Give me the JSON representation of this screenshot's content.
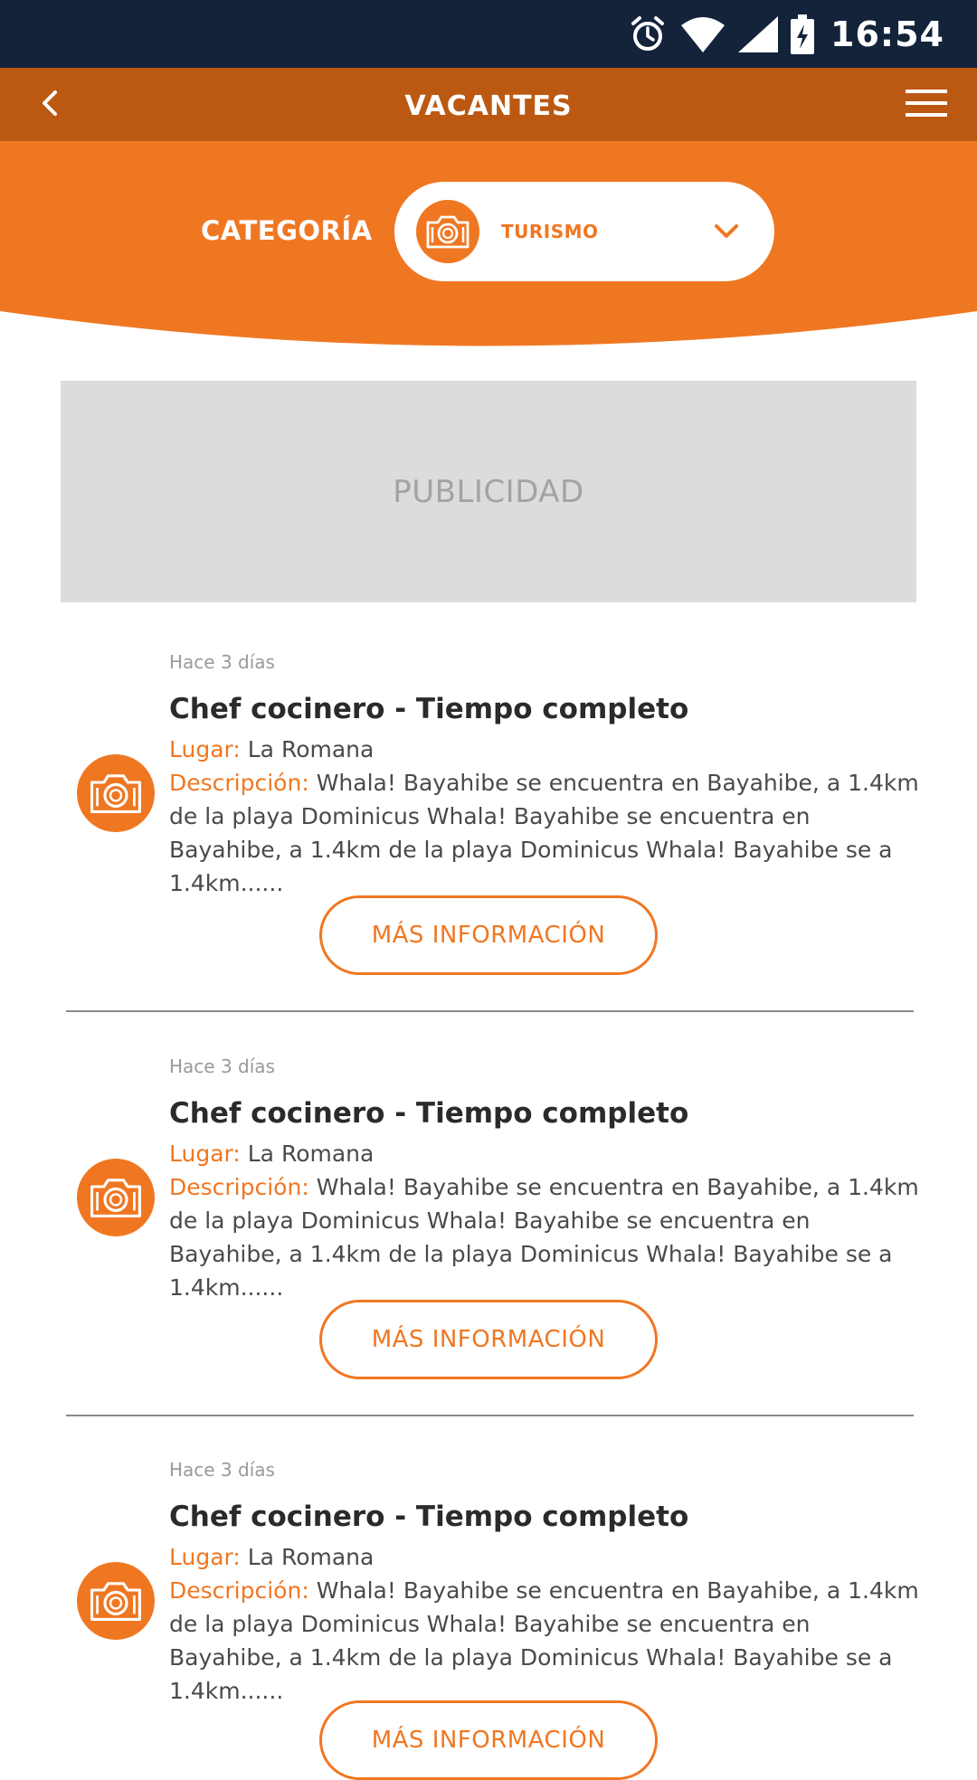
{
  "status": {
    "time": "16:54"
  },
  "header": {
    "title": "VACANTES"
  },
  "category": {
    "label": "CATEGORÍA",
    "selected": "TURISMO"
  },
  "ad": {
    "label": "PUBLICIDAD"
  },
  "jobs": [
    {
      "time_ago": "Hace 3 días",
      "title": "Chef cocinero - Tiempo completo",
      "place_label": "Lugar:",
      "place": "La Romana",
      "desc_label": "Descripción:",
      "desc": "Whala! Bayahibe se encuentra en Bayahibe, a 1.4km de la playa Dominicus Whala! Bayahibe se encuentra en Bayahibe, a 1.4km de la playa Dominicus Whala! Bayahibe se a 1.4km......",
      "button": "MÁS INFORMACIÓN"
    },
    {
      "time_ago": "Hace 3 días",
      "title": "Chef cocinero - Tiempo completo",
      "place_label": "Lugar:",
      "place": "La Romana",
      "desc_label": "Descripción:",
      "desc": "Whala! Bayahibe se encuentra en Bayahibe, a 1.4km de la playa Dominicus Whala! Bayahibe se encuentra en Bayahibe, a 1.4km de la playa Dominicus Whala! Bayahibe se a 1.4km......",
      "button": "MÁS INFORMACIÓN"
    },
    {
      "time_ago": "Hace 3 días",
      "title": "Chef cocinero - Tiempo completo",
      "place_label": "Lugar:",
      "place": "La Romana",
      "desc_label": "Descripción:",
      "desc": "Whala! Bayahibe se encuentra en Bayahibe, a 1.4km de la playa Dominicus Whala! Bayahibe se encuentra en Bayahibe, a 1.4km de la playa Dominicus Whala! Bayahibe se a 1.4km......",
      "button": "MÁS INFORMACIÓN"
    }
  ],
  "colors": {
    "accent": "#f07722",
    "appbar": "#bb5912",
    "statusbar": "#13233a"
  },
  "icons": [
    "alarm-icon",
    "wifi-icon",
    "signal-icon",
    "battery-icon",
    "back-icon",
    "menu-icon",
    "camera-icon",
    "chevron-down-icon"
  ]
}
